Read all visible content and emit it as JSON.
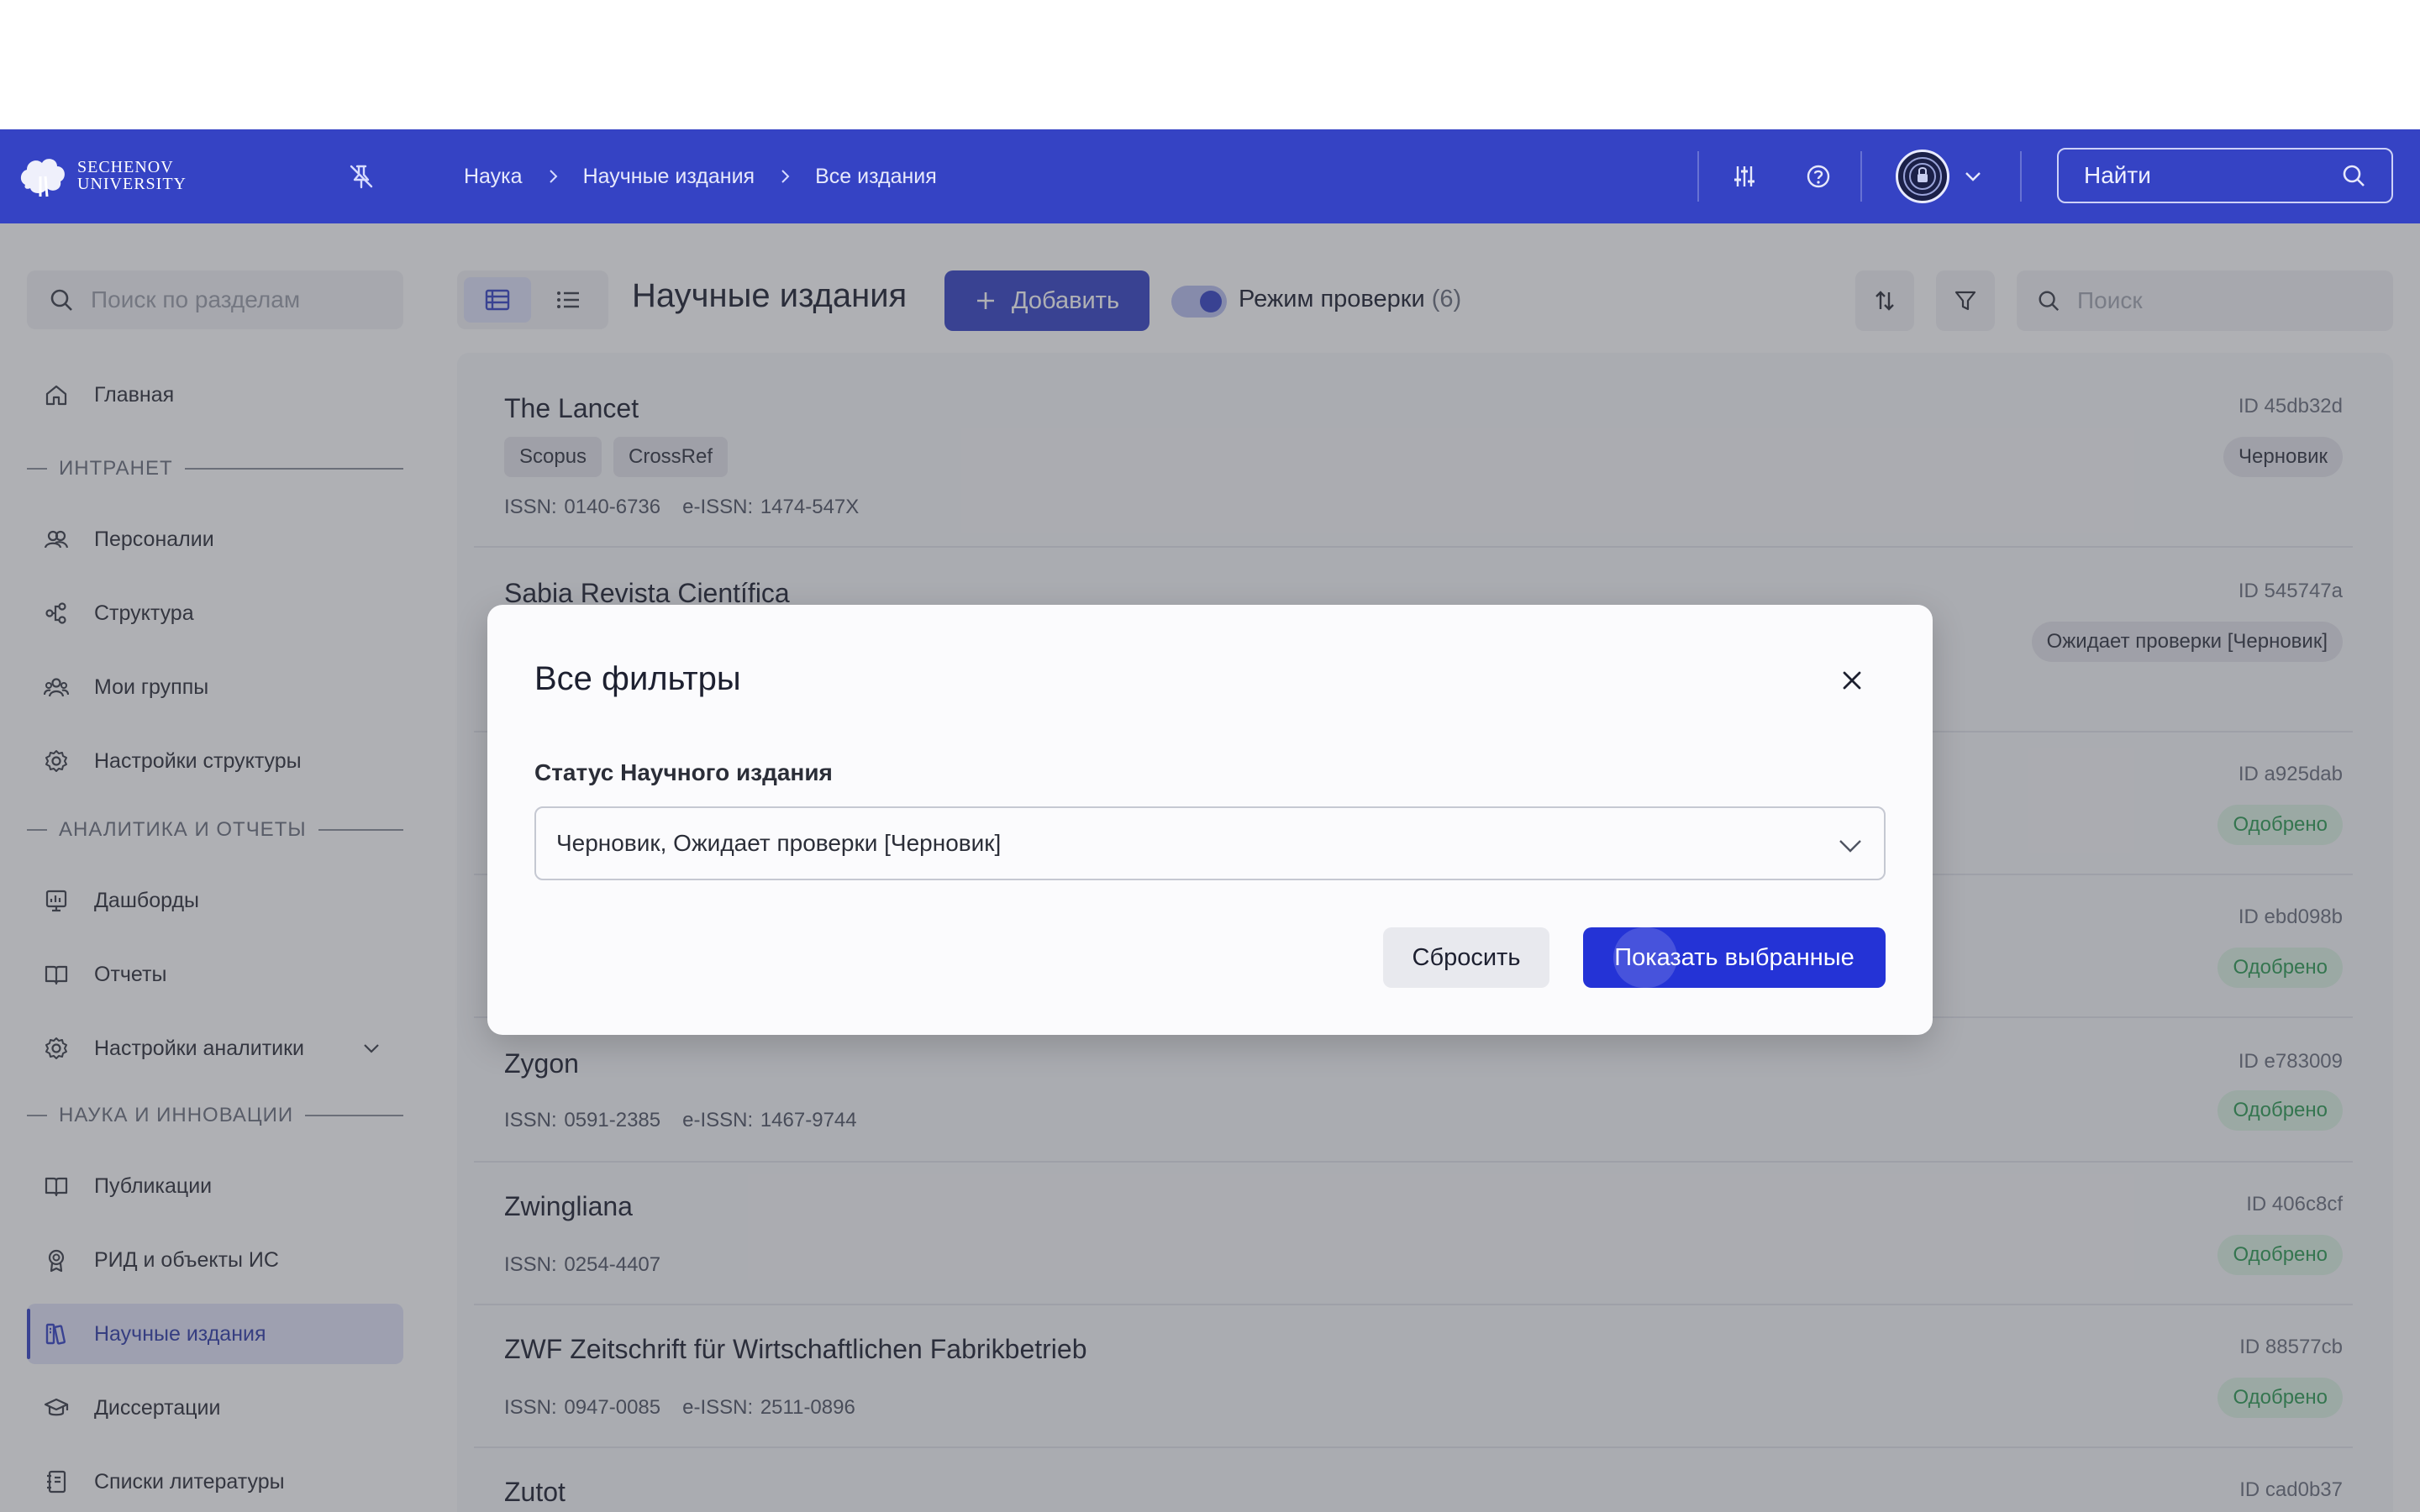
{
  "header": {
    "logo_line1": "Sechenov",
    "logo_line2": "University",
    "breadcrumb": [
      "Наука",
      "Научные издания",
      "Все издания"
    ],
    "search_placeholder": "Найти"
  },
  "sidebar": {
    "search_placeholder": "Поиск по разделам",
    "home": "Главная",
    "sections": [
      {
        "label": "ИНТРАНЕТ",
        "items": [
          "Персоналии",
          "Структура",
          "Мои группы",
          "Настройки структуры"
        ]
      },
      {
        "label": "АНАЛИТИКА И ОТЧЕТЫ",
        "items": [
          "Дашборды",
          "Отчеты",
          "Настройки аналитики"
        ]
      },
      {
        "label": "НАУКА И ИННОВАЦИИ",
        "items": [
          "Публикации",
          "РИД и объекты ИС",
          "Научные издания",
          "Диссертации",
          "Списки литературы"
        ]
      }
    ],
    "active_item": "Научные издания"
  },
  "toolbar": {
    "title": "Научные издания",
    "add_label": "Добавить",
    "review_mode_label": "Режим проверки",
    "review_mode_count": "(6)",
    "review_mode_on": true,
    "search_placeholder": "Поиск"
  },
  "list": [
    {
      "title": "The Lancet",
      "id": "ID 45db32d",
      "tags": [
        "Scopus",
        "CrossRef"
      ],
      "issn": "ISSN: 0140-6736",
      "eissn": "e-ISSN: 1474-547X",
      "status": "Черновик"
    },
    {
      "title": "Sabia Revista Científica",
      "id": "ID 545747a",
      "tags": [],
      "issn": "",
      "eissn": "",
      "status": "Ожидает проверки [Черновик]"
    },
    {
      "title": "",
      "id": "ID a925dab",
      "tags": [],
      "issn": "",
      "eissn": "",
      "status": "Одобрено"
    },
    {
      "title": "",
      "id": "ID ebd098b",
      "tags": [],
      "issn": "",
      "eissn": "",
      "status": "Одобрено"
    },
    {
      "title": "Zygon",
      "id": "ID e783009",
      "tags": [],
      "issn": "ISSN: 0591-2385",
      "eissn": "e-ISSN: 1467-9744",
      "status": "Одобрено"
    },
    {
      "title": "Zwingliana",
      "id": "ID 406c8cf",
      "tags": [],
      "issn": "ISSN: 0254-4407",
      "eissn": "",
      "status": "Одобрено"
    },
    {
      "title": "ZWF Zeitschrift für Wirtschaftlichen Fabrikbetrieb",
      "id": "ID 88577cb",
      "tags": [],
      "issn": "ISSN: 0947-0085",
      "eissn": "e-ISSN: 2511-0896",
      "status": "Одобрено"
    },
    {
      "title": "Zutot",
      "id": "ID cad0b37",
      "tags": [],
      "issn": "",
      "eissn": "",
      "status": ""
    }
  ],
  "modal": {
    "title": "Все фильтры",
    "field_label": "Статус Научного издания",
    "field_value": "Черновик, Ожидает проверки [Черновик]",
    "reset_label": "Сбросить",
    "apply_label": "Показать выбранные"
  },
  "colors": {
    "brand": "#3543c4",
    "primary_button": "#2433d6",
    "approved_text": "#2c9a52",
    "approved_bg": "#ddf3e3"
  }
}
